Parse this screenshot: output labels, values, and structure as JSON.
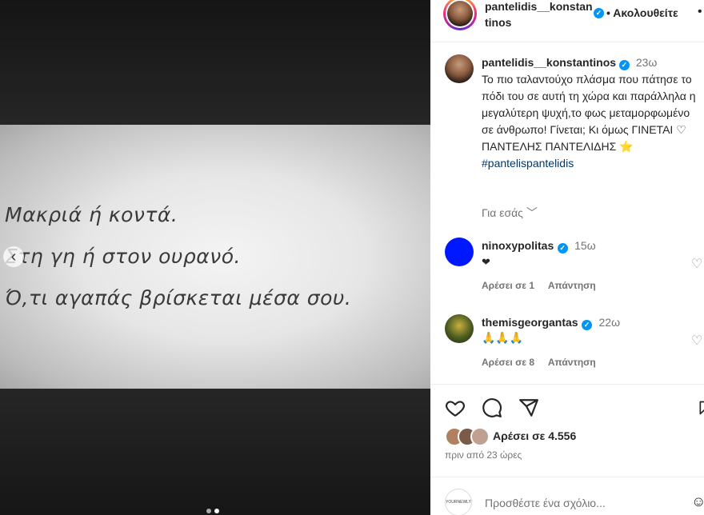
{
  "media": {
    "quote_lines": [
      "Μακριά ή κοντά.",
      "Στη γη ή στον ουρανό.",
      "Ό,τι αγαπάς βρίσκεται μέσα σου."
    ],
    "prev_glyph": "‹"
  },
  "header": {
    "username": "pantelidis__konstantinos",
    "follow_label": "• Ακολουθείτε",
    "more_glyph": "•"
  },
  "caption": {
    "username": "pantelidis__konstantinos",
    "time": "23ω",
    "text_lines": [
      "Το πιο ταλαντούχο πλάσμα που πάτησε το πόδι του σε αυτή τη χώρα και παράλληλα η μεγαλύτερη ψυχή,το φως μεταμορφωμένο σε άνθρωπο! Γίνεται; Κι όμως ΓΙΝΕΤΑΙ ♡",
      "ΠΑΝΤΕΛΗΣ ΠΑΝΤΕΛΙΔΗΣ ⭐"
    ],
    "hashtag": "#pantelispantelidis",
    "translate_label": "Για εσάς ﹀"
  },
  "comments": [
    {
      "username": "ninoxypolitas",
      "time": "15ω",
      "text": "❤",
      "likes": "Αρέσει σε 1",
      "reply": "Απάντηση",
      "avatar_color": "#0018ff"
    },
    {
      "username": "themisgeorgantas",
      "time": "22ω",
      "text": "🙏🙏🙏",
      "likes": "Αρέσει σε 8",
      "reply": "Απάντηση",
      "avatar_color": "#3b4a1e"
    }
  ],
  "engagement": {
    "likes_label": "Αρέσει σε 4.556",
    "posted_ago": "πριν από 23 ώρες"
  },
  "add_comment": {
    "placeholder": "Προσθέστε ένα σχόλιο...",
    "avatar_text": "YOURNEWLY"
  },
  "icons": [
    "heart-icon",
    "comment-icon",
    "share-icon",
    "bookmark-icon",
    "emoji-icon",
    "verified-icon"
  ],
  "colors": {
    "accent": "#0095f6",
    "hashtag": "#00376b",
    "muted": "#737373"
  }
}
